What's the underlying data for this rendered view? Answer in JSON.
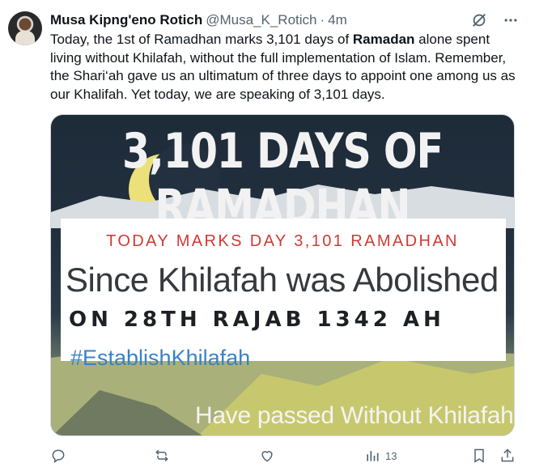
{
  "tweet": {
    "author_name": "Musa Kipng'eno Rotich",
    "author_handle": "@Musa_K_Rotich",
    "separator": "·",
    "time": "4m",
    "text_before_bold": "Today, the 1st of Ramadhan marks 3,101 days of ",
    "text_bold": "Ramadan",
    "text_after_bold": " alone spent living without Khilafah, without the full implementation of Islam. Remember, the Shari‘ah gave us an ultimatum of three days to appoint one among us as our Khalifah. Yet today, we are speaking of 3,101 days."
  },
  "media": {
    "title": "3,101 DAYS OF RAMADHAN",
    "line1": "TODAY MARKS DAY 3,101 RAMADHAN",
    "line2": "Since Khilafah was Abolished",
    "line3": "ON 28TH RAJAB 1342 AH",
    "hashtag": "#EstablishKhilafah",
    "bottom_text": "Have passed Without Khilafah"
  },
  "actions": {
    "views_count": "13"
  },
  "icons": {
    "grok": "grok-icon",
    "more": "more-icon",
    "reply": "reply-icon",
    "retweet": "retweet-icon",
    "like": "like-icon",
    "views": "views-icon",
    "bookmark": "bookmark-icon",
    "share": "share-icon"
  },
  "colors": {
    "text": "#0f1419",
    "secondary": "#536471",
    "image_red": "#d03a33",
    "image_blue": "#3a82c6"
  }
}
